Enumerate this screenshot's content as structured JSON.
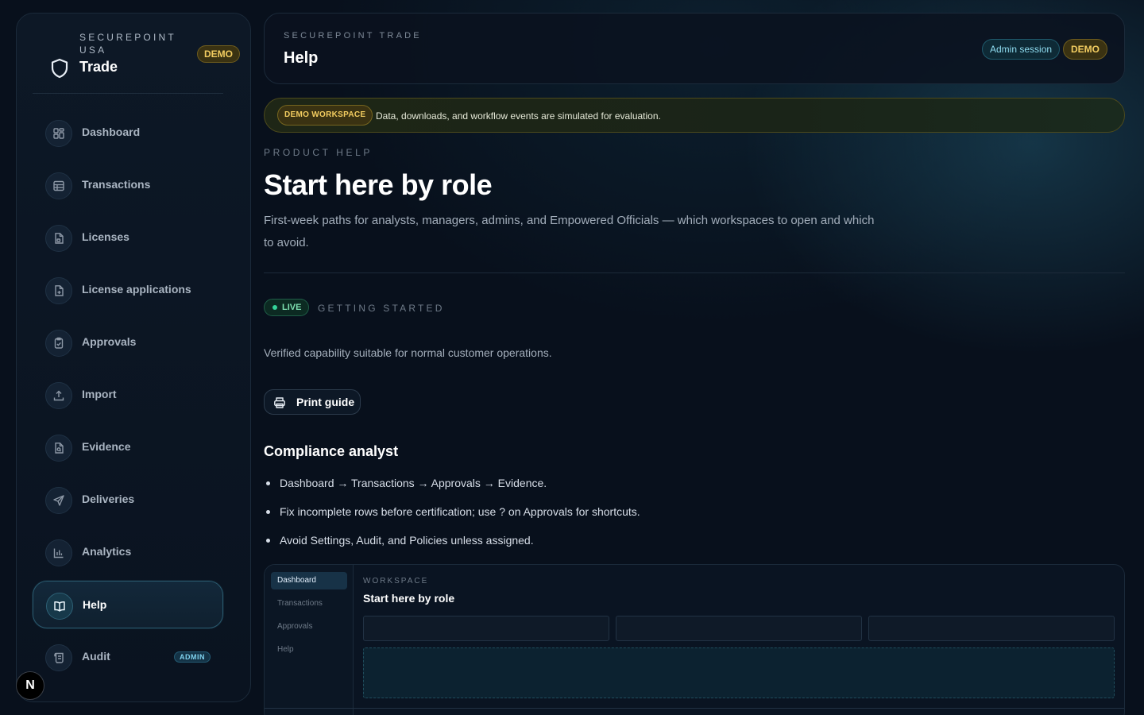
{
  "brand": {
    "org": "SECUREPOINT USA",
    "app": "Trade",
    "badge": "DEMO"
  },
  "sidebar": {
    "items": [
      {
        "label": "Dashboard",
        "icon": "grid-icon"
      },
      {
        "label": "Transactions",
        "icon": "table-icon"
      },
      {
        "label": "Licenses",
        "icon": "file-license-icon"
      },
      {
        "label": "License applications",
        "icon": "file-plus-icon"
      },
      {
        "label": "Approvals",
        "icon": "clipboard-check-icon"
      },
      {
        "label": "Import",
        "icon": "upload-icon"
      },
      {
        "label": "Evidence",
        "icon": "file-search-icon"
      },
      {
        "label": "Deliveries",
        "icon": "send-icon"
      },
      {
        "label": "Analytics",
        "icon": "bar-chart-icon"
      },
      {
        "label": "Help",
        "icon": "book-open-icon",
        "active": true
      },
      {
        "label": "Audit",
        "icon": "scroll-icon",
        "badge": "ADMIN"
      }
    ],
    "fab": "N"
  },
  "header": {
    "eyebrow": "SECUREPOINT TRADE",
    "title": "Help",
    "session_badge": "Admin session",
    "demo_badge": "DEMO"
  },
  "banner": {
    "pill": "DEMO WORKSPACE",
    "text": "Data, downloads, and workflow events are simulated for evaluation."
  },
  "main": {
    "kicker": "PRODUCT HELP",
    "title": "Start here by role",
    "lead": "First-week paths for analysts, managers, admins, and Empowered Officials — which workspaces to open and which to avoid.",
    "status_pill": "LIVE",
    "section_label": "GETTING STARTED",
    "verified_text": "Verified capability suitable for normal customer operations.",
    "print_button": "Print guide",
    "role_heading": "Compliance analyst",
    "bullets": [
      "Dashboard → Transactions → Approvals → Evidence.",
      "Fix incomplete rows before certification; use ? on Approvals for shortcuts.",
      "Avoid Settings, Audit, and Policies unless assigned."
    ]
  },
  "preview": {
    "nav": [
      "Dashboard",
      "Transactions",
      "Approvals",
      "Help"
    ],
    "eyebrow": "WORKSPACE",
    "title": "Start here by role"
  },
  "colors": {
    "accent": "#2a5a6e",
    "demo": "#f2cc60",
    "live": "#34d399",
    "background": "#08101c"
  }
}
